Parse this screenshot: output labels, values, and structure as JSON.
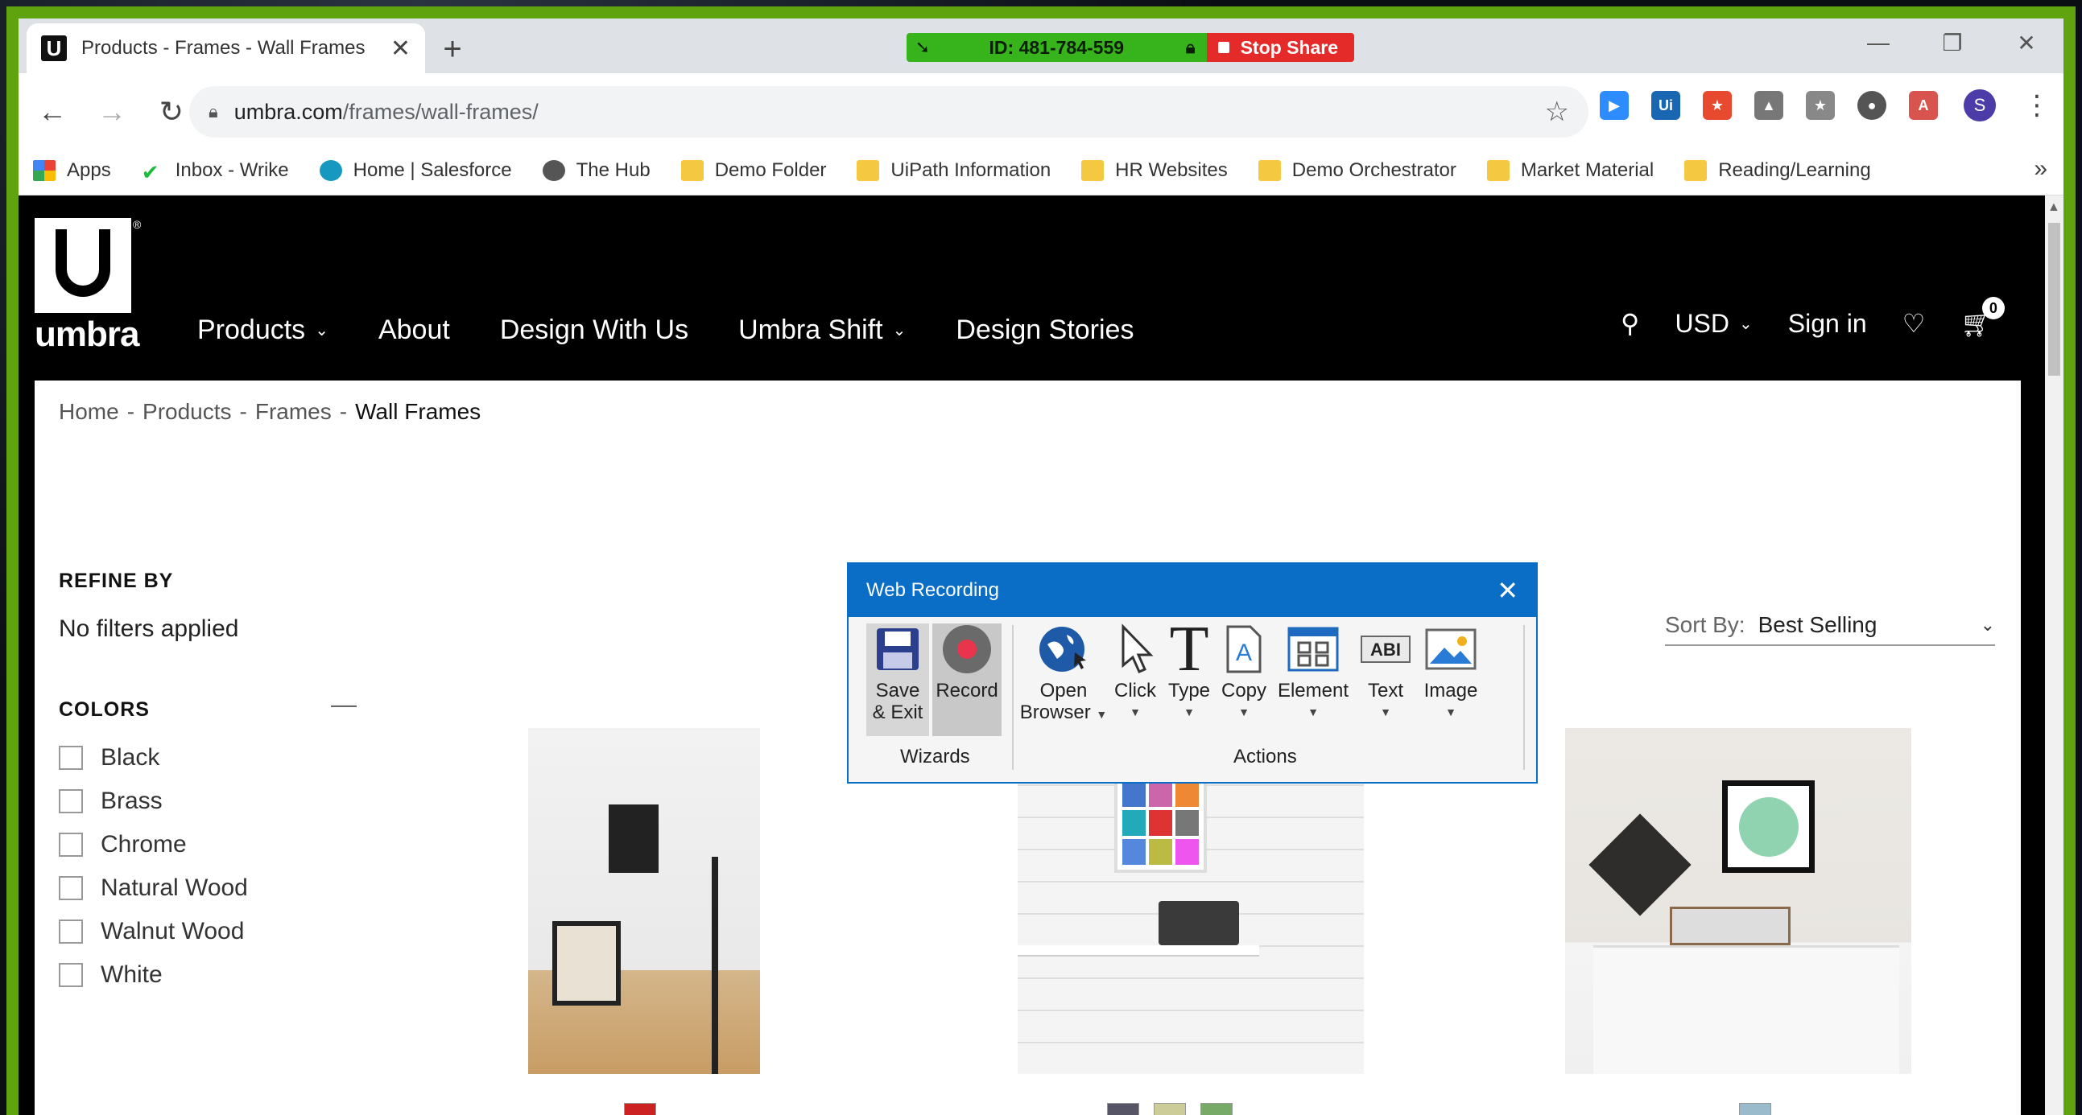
{
  "browser": {
    "tab_title": "Products - Frames - Wall Frames",
    "tab_favicon": "U",
    "tab_close": "✕",
    "new_tab": "+",
    "url_domain": "umbra.com",
    "url_path": "/frames/wall-frames/",
    "avatar_letter": "S",
    "bookmarks": [
      {
        "label": "Apps",
        "icon": "apps-grid-icon"
      },
      {
        "label": "Inbox - Wrike",
        "icon": "wrike-check-icon"
      },
      {
        "label": "Home | Salesforce",
        "icon": "salesforce-cloud-icon"
      },
      {
        "label": "The Hub",
        "icon": "globe-icon"
      },
      {
        "label": "Demo Folder",
        "icon": "folder-icon"
      },
      {
        "label": "UiPath Information",
        "icon": "folder-icon"
      },
      {
        "label": "HR Websites",
        "icon": "folder-icon"
      },
      {
        "label": "Demo Orchestrator",
        "icon": "folder-icon"
      },
      {
        "label": "Market Material",
        "icon": "folder-icon"
      },
      {
        "label": "Reading/Learning",
        "icon": "folder-icon"
      }
    ],
    "bookmarks_more": "»"
  },
  "share": {
    "id_text": "ID: 481-784-559",
    "stop_label": "Stop Share"
  },
  "site": {
    "logo_text": "umbra",
    "logo_reg": "®",
    "nav": [
      {
        "label": "Products",
        "has_dropdown": true
      },
      {
        "label": "About",
        "has_dropdown": false
      },
      {
        "label": "Design With Us",
        "has_dropdown": false
      },
      {
        "label": "Umbra Shift",
        "has_dropdown": true
      },
      {
        "label": "Design Stories",
        "has_dropdown": false
      }
    ],
    "currency": "USD",
    "sign_in": "Sign in",
    "cart_count": "0"
  },
  "breadcrumb": {
    "items": [
      "Home",
      "Products",
      "Frames"
    ],
    "current": "Wall Frames",
    "separator": "-"
  },
  "filters": {
    "refine_title": "REFINE BY",
    "no_filters": "No filters applied",
    "colors_title": "COLORS",
    "collapse_symbol": "—",
    "colors": [
      "Black",
      "Brass",
      "Chrome",
      "Natural Wood",
      "Walnut Wood",
      "White"
    ]
  },
  "sort": {
    "label": "Sort By:",
    "value": "Best Selling"
  },
  "web_recording": {
    "title": "Web Recording",
    "close": "✕",
    "wizards_label": "Wizards",
    "actions_label": "Actions",
    "save_exit_1": "Save",
    "save_exit_2": "& Exit",
    "record": "Record",
    "open_browser_1": "Open",
    "open_browser_2": "Browser",
    "click": "Click",
    "type": "Type",
    "copy": "Copy",
    "element": "Element",
    "text": "Text",
    "image": "Image"
  },
  "colors": {
    "share_green": "#37b31c",
    "stop_red": "#e52a2a",
    "dialog_blue": "#0a6ec7",
    "frame_green": "#5fa30f"
  }
}
